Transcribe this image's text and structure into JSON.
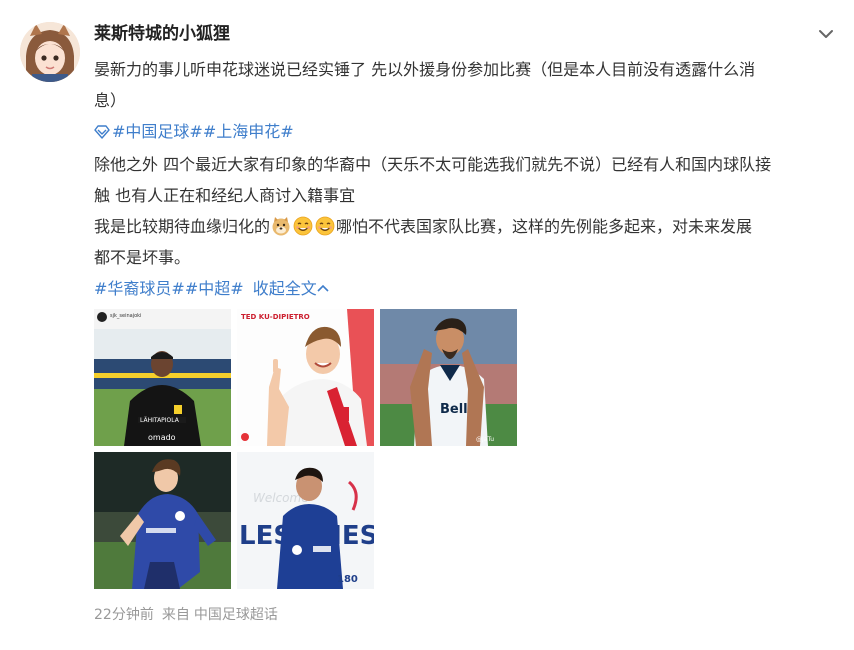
{
  "user": {
    "name": "莱斯特城的小狐狸"
  },
  "post": {
    "line1": "晏新力的事儿听申花球迷说已经实锤了 先以外援身份参加比赛（但是本人目前没有透露什么消",
    "line2": "息）",
    "topics1": [
      "#中国足球#",
      "#上海申花#"
    ],
    "line3": "除他之外 四个最近大家有印象的华裔中（天乐不太可能选我们就先不说）已经有人和国内球队接",
    "line4": "触 也有人正在和经纪人商讨入籍事宜",
    "line5_prefix": "我是比较期待血缘归化的",
    "line5_suffix": "哪怕不代表国家队比赛，这样的先例能多起来，对未来发展",
    "line6": "都不是坏事。",
    "topics2": [
      "#华裔球员#",
      "#中超#"
    ],
    "collapse_label": "收起全文"
  },
  "images": [
    {
      "caption_top": "sjk_seinajoki",
      "sponsor": "LÄHITAPIOLA",
      "sponsor2": "omado"
    },
    {
      "caption_top": "TED KU-DIPIETRO"
    },
    {
      "caption_top": "",
      "sponsor": "Bell",
      "watermark": "@JaTu"
    },
    {
      "caption_top": ""
    },
    {
      "caption_top": "Welcome",
      "big_text": "LES PNES",
      "jersey": "180"
    }
  ],
  "footer": {
    "time": "22分钟前",
    "from_label": "来自",
    "source": "中国足球超话"
  },
  "colors": {
    "link": "#3f7ecb",
    "meta": "#999999",
    "text": "#333333"
  }
}
